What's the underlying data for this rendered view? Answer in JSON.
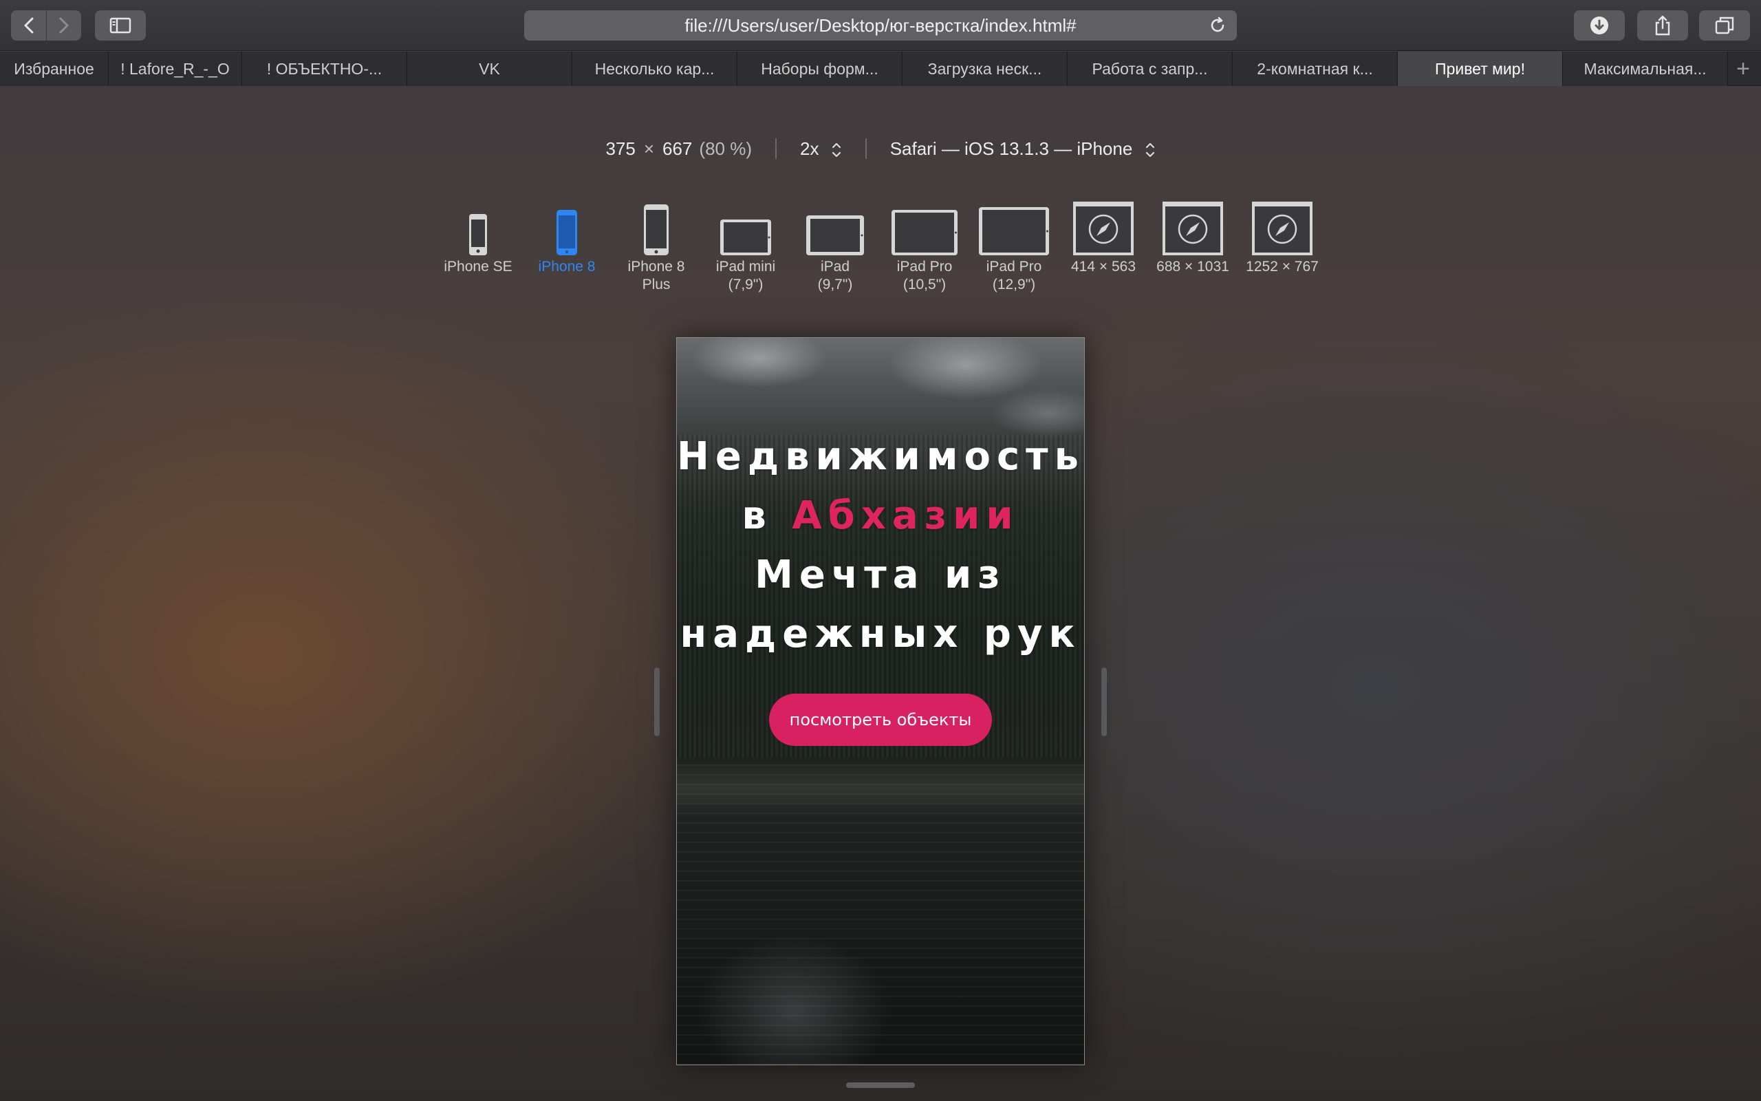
{
  "browser": {
    "url": "file:///Users/user/Desktop/юг-верстка/index.html#",
    "tabs": [
      {
        "label": "Избранное",
        "active": false
      },
      {
        "label": "! Lafore_R_-_O",
        "active": false
      },
      {
        "label": "! ОБЪЕКТНО-...",
        "active": false
      },
      {
        "label": "VK",
        "active": false
      },
      {
        "label": "Несколько кар...",
        "active": false
      },
      {
        "label": "Наборы форм...",
        "active": false
      },
      {
        "label": "Загрузка неск...",
        "active": false
      },
      {
        "label": "Работа с запр...",
        "active": false
      },
      {
        "label": "2-комнатная к...",
        "active": false
      },
      {
        "label": "Привет мир!",
        "active": true
      },
      {
        "label": "Максимальная...",
        "active": false
      }
    ],
    "add_tab": "+"
  },
  "responsive": {
    "width": "375",
    "times": "×",
    "height": "667",
    "zoom": "(80 %)",
    "scale": "2x",
    "user_agent": "Safari — iOS 13.1.3 — iPhone",
    "devices": [
      {
        "label": "iPhone SE",
        "kind": "phone",
        "active": false
      },
      {
        "label": "iPhone 8",
        "kind": "phone",
        "active": true
      },
      {
        "label": "iPhone 8\nPlus",
        "kind": "phone-lg",
        "active": false
      },
      {
        "label": "iPad mini\n(7,9\")",
        "kind": "tablet",
        "active": false
      },
      {
        "label": "iPad\n(9,7\")",
        "kind": "tablet",
        "active": false
      },
      {
        "label": "iPad Pro\n(10,5\")",
        "kind": "tablet",
        "active": false
      },
      {
        "label": "iPad Pro\n(12,9\")",
        "kind": "tablet",
        "active": false
      },
      {
        "label": "414 × 563",
        "kind": "window",
        "active": false
      },
      {
        "label": "688 × 1031",
        "kind": "window",
        "active": false
      },
      {
        "label": "1252 × 767",
        "kind": "window",
        "active": false
      }
    ]
  },
  "page": {
    "title_line1": "Недвижимость",
    "title_line2_prefix": "в ",
    "title_line2_accent": "Абхазии",
    "title_line3": "Мечта из",
    "title_line4": "надежных рук",
    "cta": "посмотреть объекты"
  },
  "colors": {
    "accent": "#df2561",
    "cta_bg": "#d82160",
    "active_device": "#2f86f3"
  }
}
